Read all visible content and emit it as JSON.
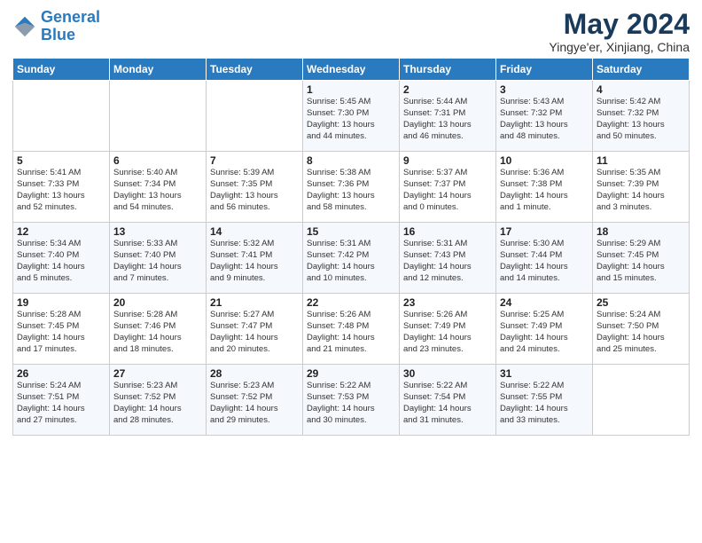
{
  "header": {
    "logo_line1": "General",
    "logo_line2": "Blue",
    "month_title": "May 2024",
    "location": "Yingye'er, Xinjiang, China"
  },
  "days_of_week": [
    "Sunday",
    "Monday",
    "Tuesday",
    "Wednesday",
    "Thursday",
    "Friday",
    "Saturday"
  ],
  "weeks": [
    [
      {
        "day": "",
        "info": ""
      },
      {
        "day": "",
        "info": ""
      },
      {
        "day": "",
        "info": ""
      },
      {
        "day": "1",
        "info": "Sunrise: 5:45 AM\nSunset: 7:30 PM\nDaylight: 13 hours\nand 44 minutes."
      },
      {
        "day": "2",
        "info": "Sunrise: 5:44 AM\nSunset: 7:31 PM\nDaylight: 13 hours\nand 46 minutes."
      },
      {
        "day": "3",
        "info": "Sunrise: 5:43 AM\nSunset: 7:32 PM\nDaylight: 13 hours\nand 48 minutes."
      },
      {
        "day": "4",
        "info": "Sunrise: 5:42 AM\nSunset: 7:32 PM\nDaylight: 13 hours\nand 50 minutes."
      }
    ],
    [
      {
        "day": "5",
        "info": "Sunrise: 5:41 AM\nSunset: 7:33 PM\nDaylight: 13 hours\nand 52 minutes."
      },
      {
        "day": "6",
        "info": "Sunrise: 5:40 AM\nSunset: 7:34 PM\nDaylight: 13 hours\nand 54 minutes."
      },
      {
        "day": "7",
        "info": "Sunrise: 5:39 AM\nSunset: 7:35 PM\nDaylight: 13 hours\nand 56 minutes."
      },
      {
        "day": "8",
        "info": "Sunrise: 5:38 AM\nSunset: 7:36 PM\nDaylight: 13 hours\nand 58 minutes."
      },
      {
        "day": "9",
        "info": "Sunrise: 5:37 AM\nSunset: 7:37 PM\nDaylight: 14 hours\nand 0 minutes."
      },
      {
        "day": "10",
        "info": "Sunrise: 5:36 AM\nSunset: 7:38 PM\nDaylight: 14 hours\nand 1 minute."
      },
      {
        "day": "11",
        "info": "Sunrise: 5:35 AM\nSunset: 7:39 PM\nDaylight: 14 hours\nand 3 minutes."
      }
    ],
    [
      {
        "day": "12",
        "info": "Sunrise: 5:34 AM\nSunset: 7:40 PM\nDaylight: 14 hours\nand 5 minutes."
      },
      {
        "day": "13",
        "info": "Sunrise: 5:33 AM\nSunset: 7:40 PM\nDaylight: 14 hours\nand 7 minutes."
      },
      {
        "day": "14",
        "info": "Sunrise: 5:32 AM\nSunset: 7:41 PM\nDaylight: 14 hours\nand 9 minutes."
      },
      {
        "day": "15",
        "info": "Sunrise: 5:31 AM\nSunset: 7:42 PM\nDaylight: 14 hours\nand 10 minutes."
      },
      {
        "day": "16",
        "info": "Sunrise: 5:31 AM\nSunset: 7:43 PM\nDaylight: 14 hours\nand 12 minutes."
      },
      {
        "day": "17",
        "info": "Sunrise: 5:30 AM\nSunset: 7:44 PM\nDaylight: 14 hours\nand 14 minutes."
      },
      {
        "day": "18",
        "info": "Sunrise: 5:29 AM\nSunset: 7:45 PM\nDaylight: 14 hours\nand 15 minutes."
      }
    ],
    [
      {
        "day": "19",
        "info": "Sunrise: 5:28 AM\nSunset: 7:45 PM\nDaylight: 14 hours\nand 17 minutes."
      },
      {
        "day": "20",
        "info": "Sunrise: 5:28 AM\nSunset: 7:46 PM\nDaylight: 14 hours\nand 18 minutes."
      },
      {
        "day": "21",
        "info": "Sunrise: 5:27 AM\nSunset: 7:47 PM\nDaylight: 14 hours\nand 20 minutes."
      },
      {
        "day": "22",
        "info": "Sunrise: 5:26 AM\nSunset: 7:48 PM\nDaylight: 14 hours\nand 21 minutes."
      },
      {
        "day": "23",
        "info": "Sunrise: 5:26 AM\nSunset: 7:49 PM\nDaylight: 14 hours\nand 23 minutes."
      },
      {
        "day": "24",
        "info": "Sunrise: 5:25 AM\nSunset: 7:49 PM\nDaylight: 14 hours\nand 24 minutes."
      },
      {
        "day": "25",
        "info": "Sunrise: 5:24 AM\nSunset: 7:50 PM\nDaylight: 14 hours\nand 25 minutes."
      }
    ],
    [
      {
        "day": "26",
        "info": "Sunrise: 5:24 AM\nSunset: 7:51 PM\nDaylight: 14 hours\nand 27 minutes."
      },
      {
        "day": "27",
        "info": "Sunrise: 5:23 AM\nSunset: 7:52 PM\nDaylight: 14 hours\nand 28 minutes."
      },
      {
        "day": "28",
        "info": "Sunrise: 5:23 AM\nSunset: 7:52 PM\nDaylight: 14 hours\nand 29 minutes."
      },
      {
        "day": "29",
        "info": "Sunrise: 5:22 AM\nSunset: 7:53 PM\nDaylight: 14 hours\nand 30 minutes."
      },
      {
        "day": "30",
        "info": "Sunrise: 5:22 AM\nSunset: 7:54 PM\nDaylight: 14 hours\nand 31 minutes."
      },
      {
        "day": "31",
        "info": "Sunrise: 5:22 AM\nSunset: 7:55 PM\nDaylight: 14 hours\nand 33 minutes."
      },
      {
        "day": "",
        "info": ""
      }
    ]
  ]
}
